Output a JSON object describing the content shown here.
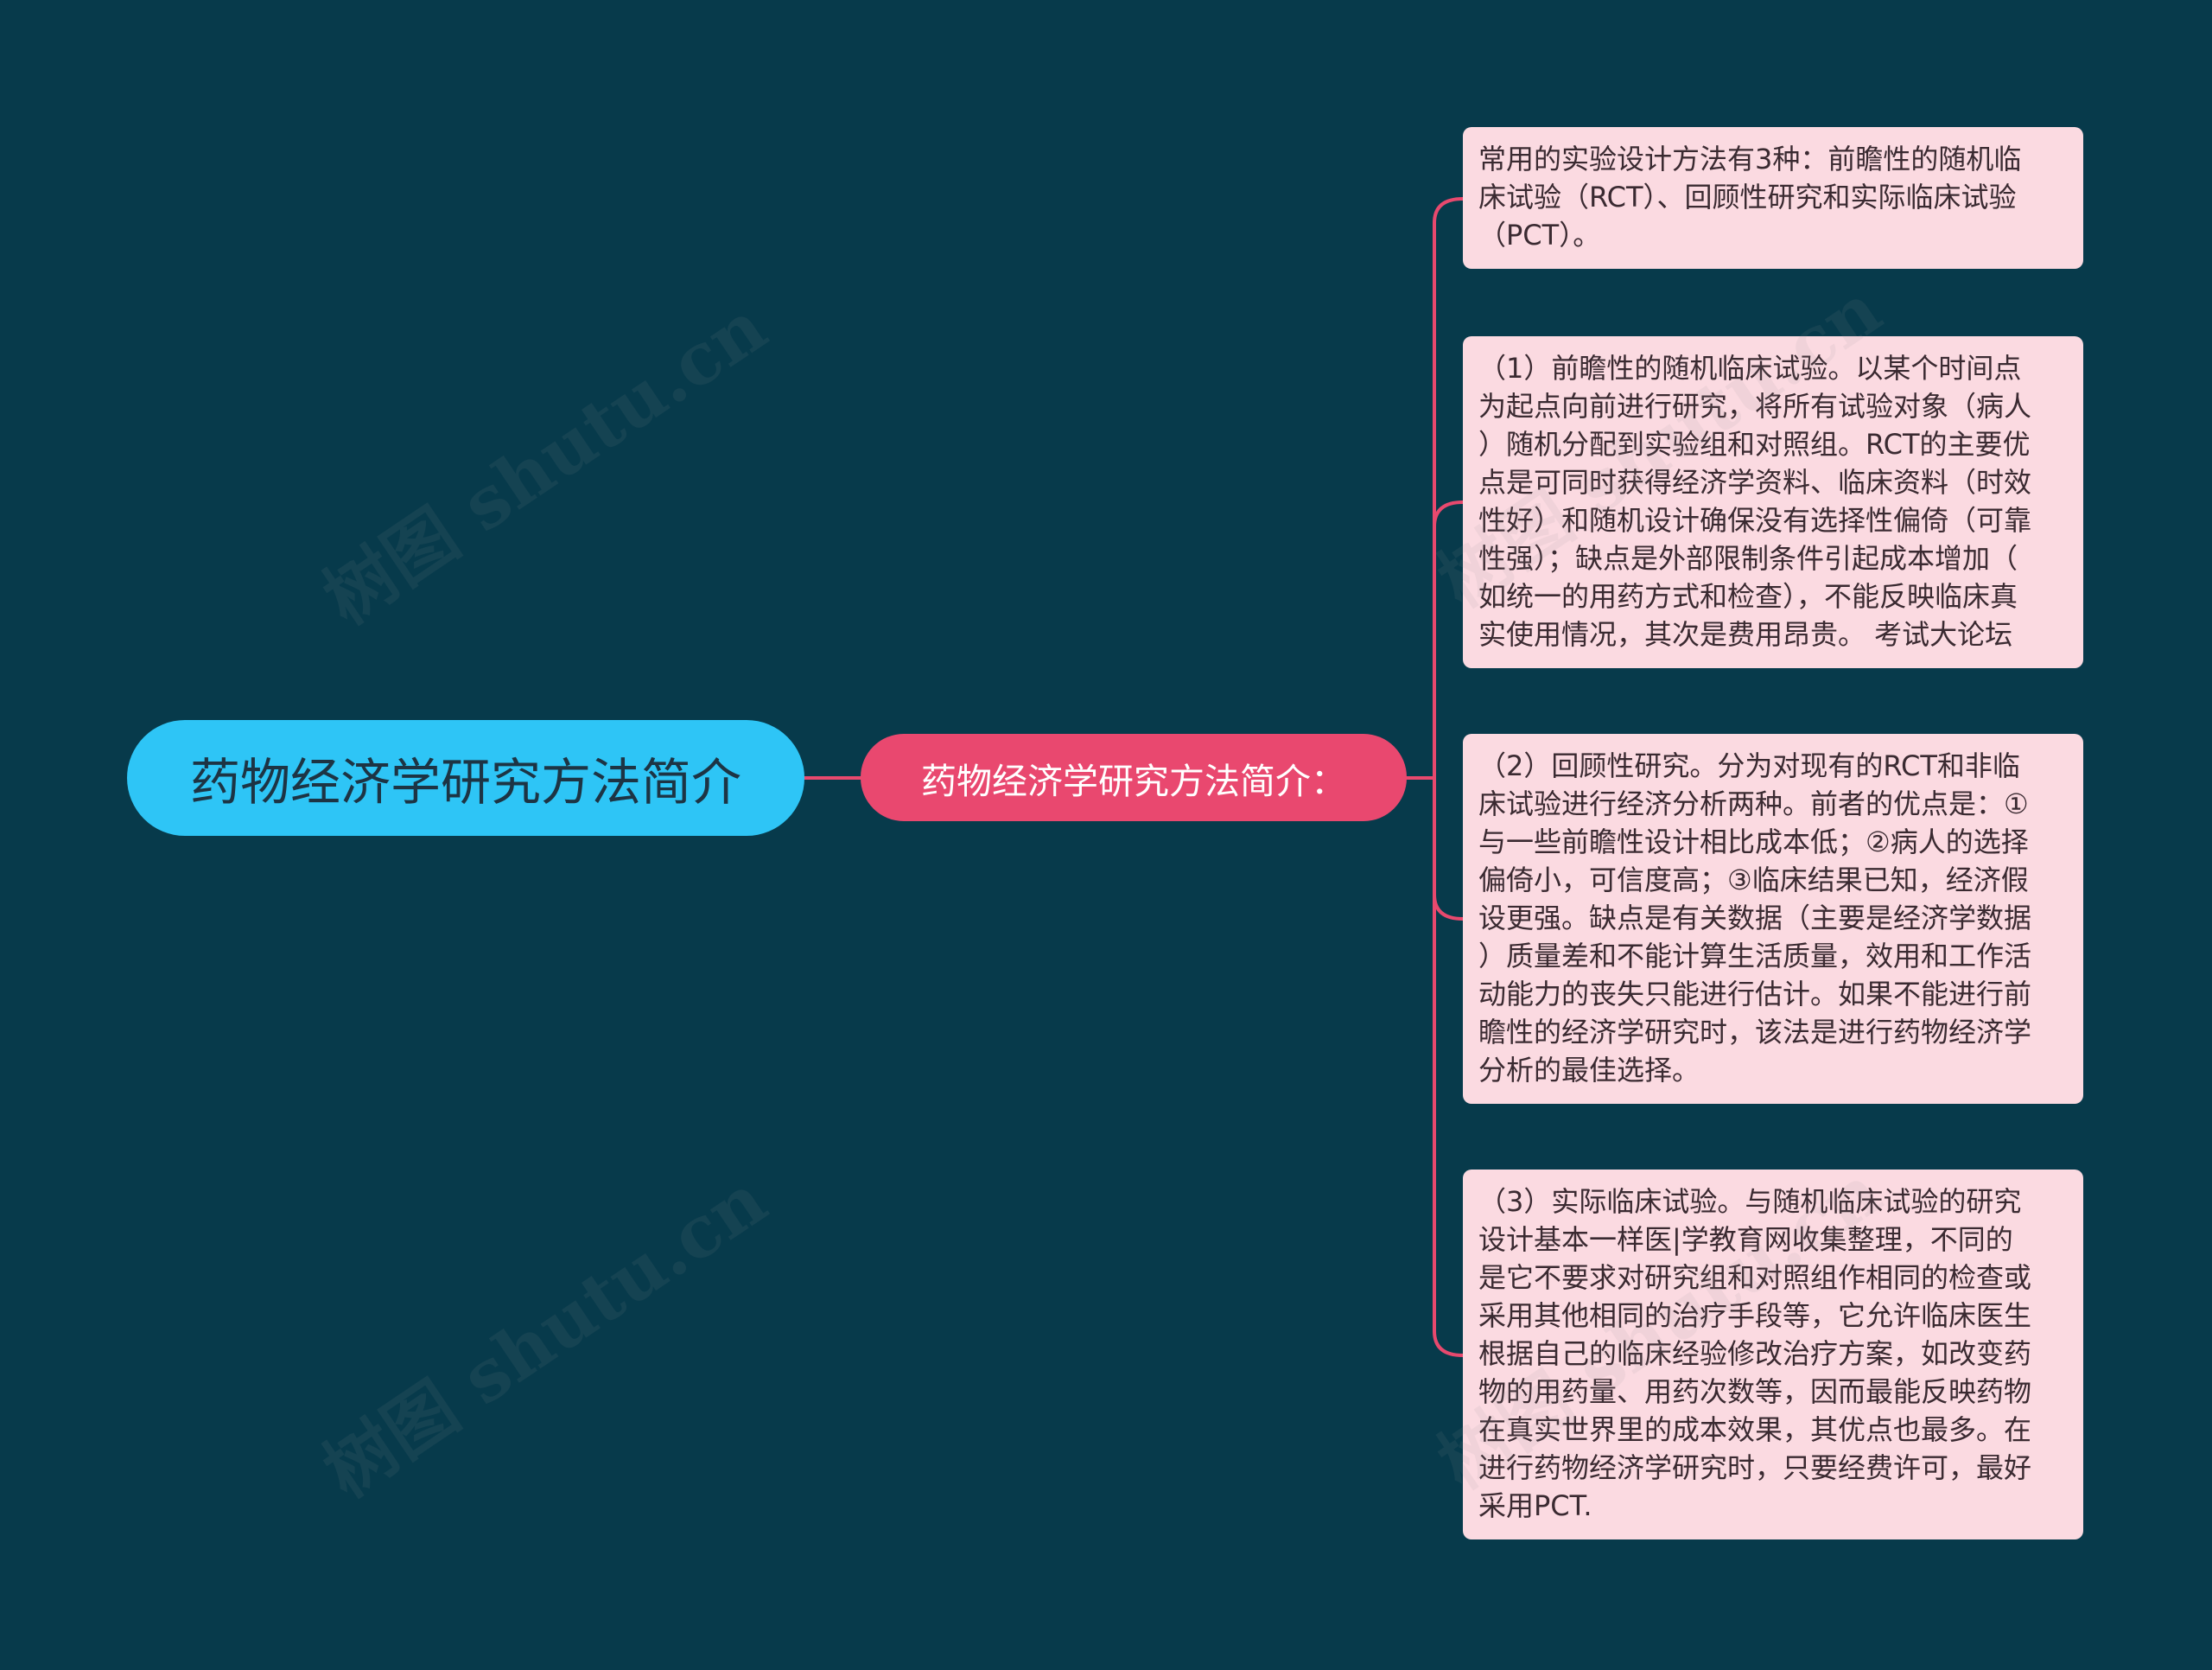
{
  "root": {
    "label": "药物经济学研究方法简介"
  },
  "branch": {
    "label": "药物经济学研究方法简介："
  },
  "leaves": [
    {
      "lines": [
        "常用的实验设计方法有3种：前瞻性的随机临",
        "床试验（RCT）、回顾性研究和实际临床试验",
        "（PCT）。"
      ]
    },
    {
      "lines": [
        "（1）前瞻性的随机临床试验。以某个时间点",
        "为起点向前进行研究，将所有试验对象（病人",
        "）随机分配到实验组和对照组。RCT的主要优",
        "点是可同时获得经济学资料、临床资料（时效",
        "性好）和随机设计确保没有选择性偏倚（可靠",
        "性强）；缺点是外部限制条件引起成本增加（",
        "如统一的用药方式和检查），不能反映临床真",
        "实使用情况，其次是费用昂贵。 考试大论坛"
      ]
    },
    {
      "lines": [
        "（2）回顾性研究。分为对现有的RCT和非临",
        "床试验进行经济分析两种。前者的优点是：①",
        "与一些前瞻性设计相比成本低；②病人的选择",
        "偏倚小，可信度高；③临床结果已知，经济假",
        "设更强。缺点是有关数据（主要是经济学数据",
        "）质量差和不能计算生活质量，效用和工作活",
        "动能力的丧失只能进行估计。如果不能进行前",
        "瞻性的经济学研究时，该法是进行药物经济学",
        "分析的最佳选择。"
      ]
    },
    {
      "lines": [
        "（3）实际临床试验。与随机临床试验的研究",
        "设计基本一样医|学教育网收集整理，不同的",
        "是它不要求对研究组和对照组作相同的检查或",
        "采用其他相同的治疗手段等，它允许临床医生",
        "根据自己的临床经验修改治疗方案，如改变药",
        "物的用药量、用药次数等，因而最能反映药物",
        "在真实世界里的成本效果，其优点也最多。在",
        "进行药物经济学研究时，只要经费许可，最好",
        "采用PCT."
      ]
    }
  ],
  "watermark": {
    "text": "树图 shutu.cn"
  },
  "colors": {
    "background": "#073A4B",
    "root_node": "#2EC5F6",
    "branch_node": "#E9486F",
    "connector": "#E8496E",
    "leaf_node": "#FBDAE1"
  }
}
